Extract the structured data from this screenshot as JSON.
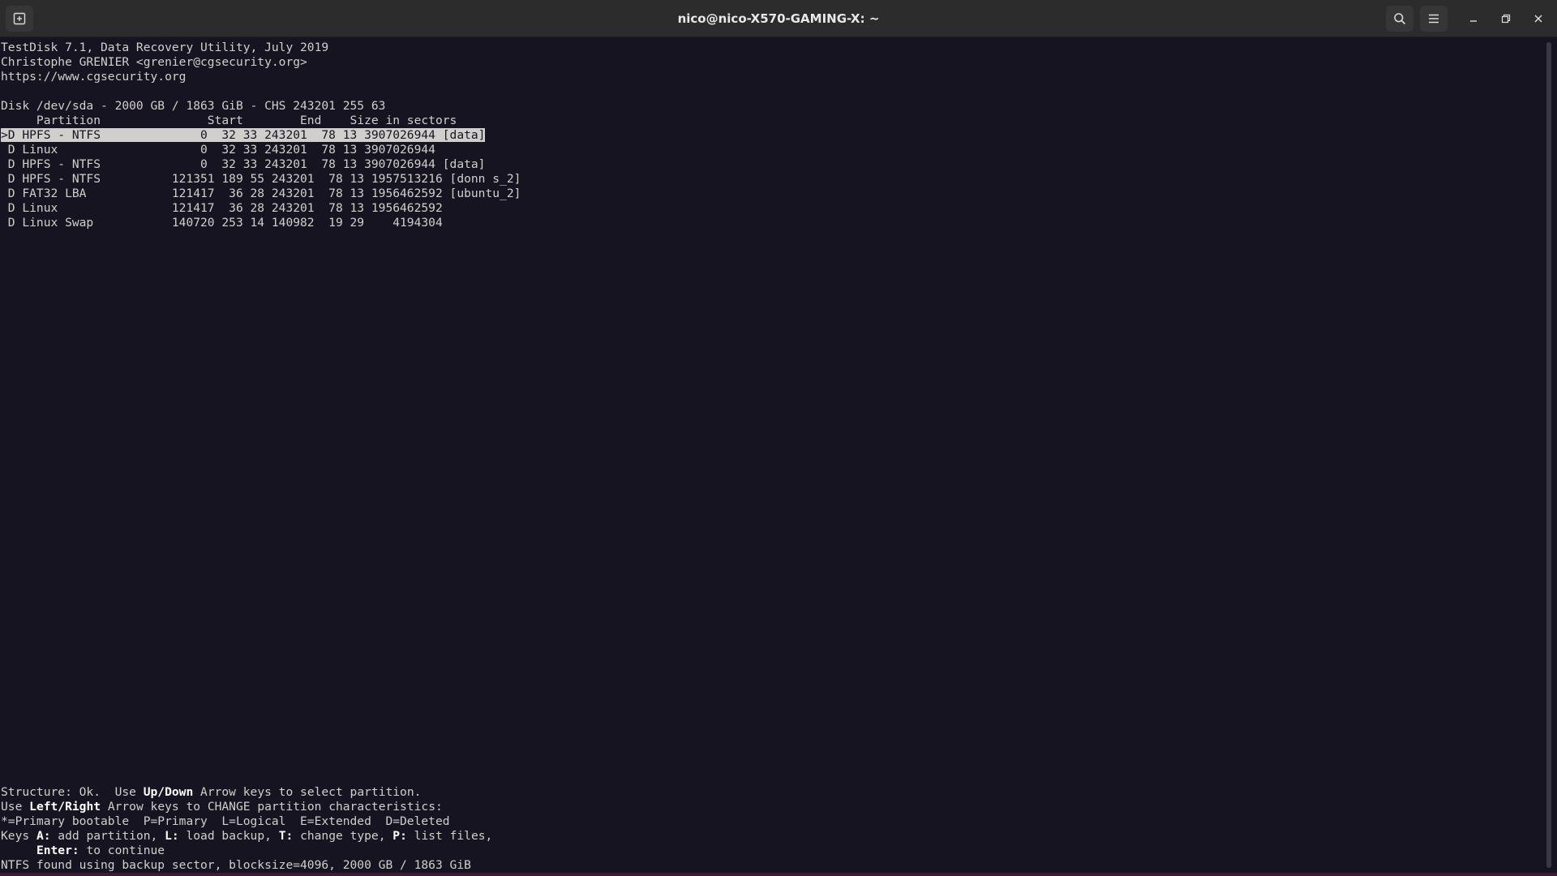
{
  "window": {
    "title": "nico@nico-X570-GAMING-X: ~"
  },
  "icons": {
    "new_tab": "new-tab-icon",
    "search": "search-icon",
    "menu": "hamburger-menu-icon",
    "minimize": "minimize-icon",
    "maximize": "maximize-icon",
    "close": "close-icon"
  },
  "colors": {
    "terminal_bg": "#171421",
    "terminal_fg": "#d0cfcc",
    "titlebar_bg": "#2c2c2c",
    "selection_bg": "#d0cfcc"
  },
  "header": {
    "line1": "TestDisk 7.1, Data Recovery Utility, July 2019",
    "line2": "Christophe GRENIER <grenier@cgsecurity.org>",
    "line3": "https://www.cgsecurity.org"
  },
  "disk": {
    "info": "Disk /dev/sda - 2000 GB / 1863 GiB - CHS 243201 255 63",
    "columns": "     Partition               Start        End    Size in sectors"
  },
  "partitions": [
    {
      "text": ">D HPFS - NTFS              0  32 33 243201  78 13 3907026944 [data]",
      "selected": true
    },
    {
      "text": " D Linux                    0  32 33 243201  78 13 3907026944",
      "selected": false
    },
    {
      "text": " D HPFS - NTFS              0  32 33 243201  78 13 3907026944 [data]",
      "selected": false
    },
    {
      "text": " D HPFS - NTFS          121351 189 55 243201  78 13 1957513216 [donn s_2]",
      "selected": false
    },
    {
      "text": " D FAT32 LBA            121417  36 28 243201  78 13 1956462592 [ubuntu_2]",
      "selected": false
    },
    {
      "text": " D Linux                121417  36 28 243201  78 13 1956462592",
      "selected": false
    },
    {
      "text": " D Linux Swap           140720 253 14 140982  19 29    4194304",
      "selected": false
    }
  ],
  "footer": {
    "structure_prefix": "Structure: Ok.  Use ",
    "structure_key": "Up/Down",
    "structure_suffix": " Arrow keys to select partition.",
    "use_prefix": "Use ",
    "use_key": "Left/Right",
    "use_suffix": " Arrow keys to CHANGE partition characteristics:",
    "legend": "*=Primary bootable  P=Primary  L=Logical  E=Extended  D=Deleted",
    "keys_prefix": "Keys ",
    "key_a": "A:",
    "key_a_text": " add partition, ",
    "key_l": "L:",
    "key_l_text": " load backup, ",
    "key_t": "T:",
    "key_t_text": " change type, ",
    "key_p": "P:",
    "key_p_text": " list files,",
    "enter_indent": "     ",
    "enter_key": "Enter:",
    "enter_text": " to continue",
    "ntfs_info": "NTFS found using backup sector, blocksize=4096, 2000 GB / 1863 GiB"
  }
}
